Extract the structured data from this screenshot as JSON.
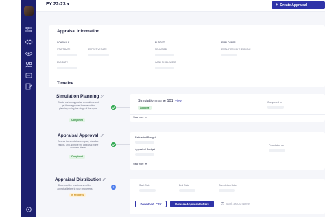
{
  "header": {
    "fiscal_year": "FY 22-23",
    "create_button": "Create Appraisal"
  },
  "info": {
    "title": "Appraisal Information",
    "schedule": "SCHEDULE",
    "budget": "BUDGET",
    "employees": "EMPLOYEES",
    "start_date": "START DATE",
    "effective_date": "EFFECTIVE DATE",
    "released": "RELEASED",
    "employees_in_cycle": "EMPLOYEES IN THE CYCLE",
    "end_date": "END DATE",
    "cash_released": "CASH IS RELEASED"
  },
  "timeline": {
    "title": "Timeline",
    "planning": {
      "title": "Simulation Planning",
      "desc": "Create various appraisal simulations and get them approved for evaluation planning during this stage of the cycle.",
      "badge": "Completed",
      "sim_name": "Simulation name 101",
      "view": "View",
      "status": "Approval",
      "completed_on": "Completed on",
      "view_more": "View more"
    },
    "approval": {
      "title": "Appraisal Approval",
      "desc": "Assess the simulation's impact, visualize results, and approve the appraisal in the concrete phase.",
      "badge": "Completed",
      "estimated": "Estimated Budget",
      "appraisal_budget": "Appraisal Budget",
      "completed_on": "Completed on",
      "view_more": "View more"
    },
    "distribution": {
      "title": "Appraisal Distribution",
      "desc": "Download the results or send the appraisal letters to your employees",
      "badge": "In Progress",
      "start_date": "Start Date",
      "end_date": "End Date",
      "completion_date": "Completion Date",
      "download": "Download .CSV",
      "release": "Release Appraisal letters",
      "mark_complete": "Mark as Complete"
    }
  }
}
